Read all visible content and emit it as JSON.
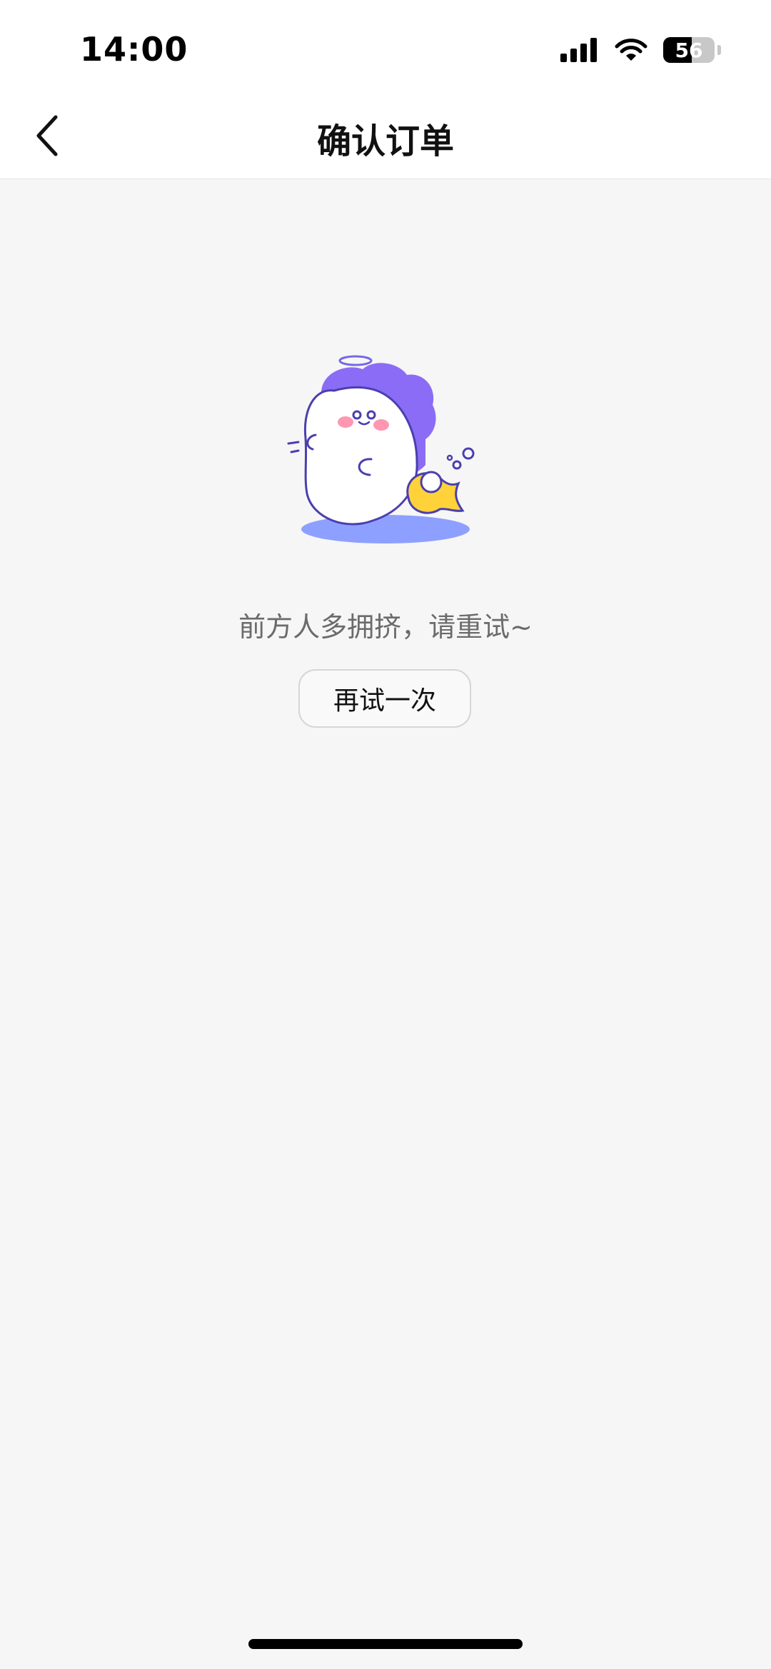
{
  "status_bar": {
    "time": "14:00",
    "battery_level": "56",
    "battery_fraction": 0.56,
    "icons": [
      "signal-icon",
      "wifi-icon",
      "battery-icon"
    ]
  },
  "nav": {
    "title": "确认订单",
    "back_icon": "chevron-left-icon"
  },
  "empty_state": {
    "illustration": "mascot-illustration",
    "message": "前方人多拥挤，请重试~",
    "retry_label": "再试一次"
  },
  "colors": {
    "accent_purple": "#8b6cf6",
    "accent_yellow": "#ffd23a",
    "background": "#f6f6f6"
  }
}
